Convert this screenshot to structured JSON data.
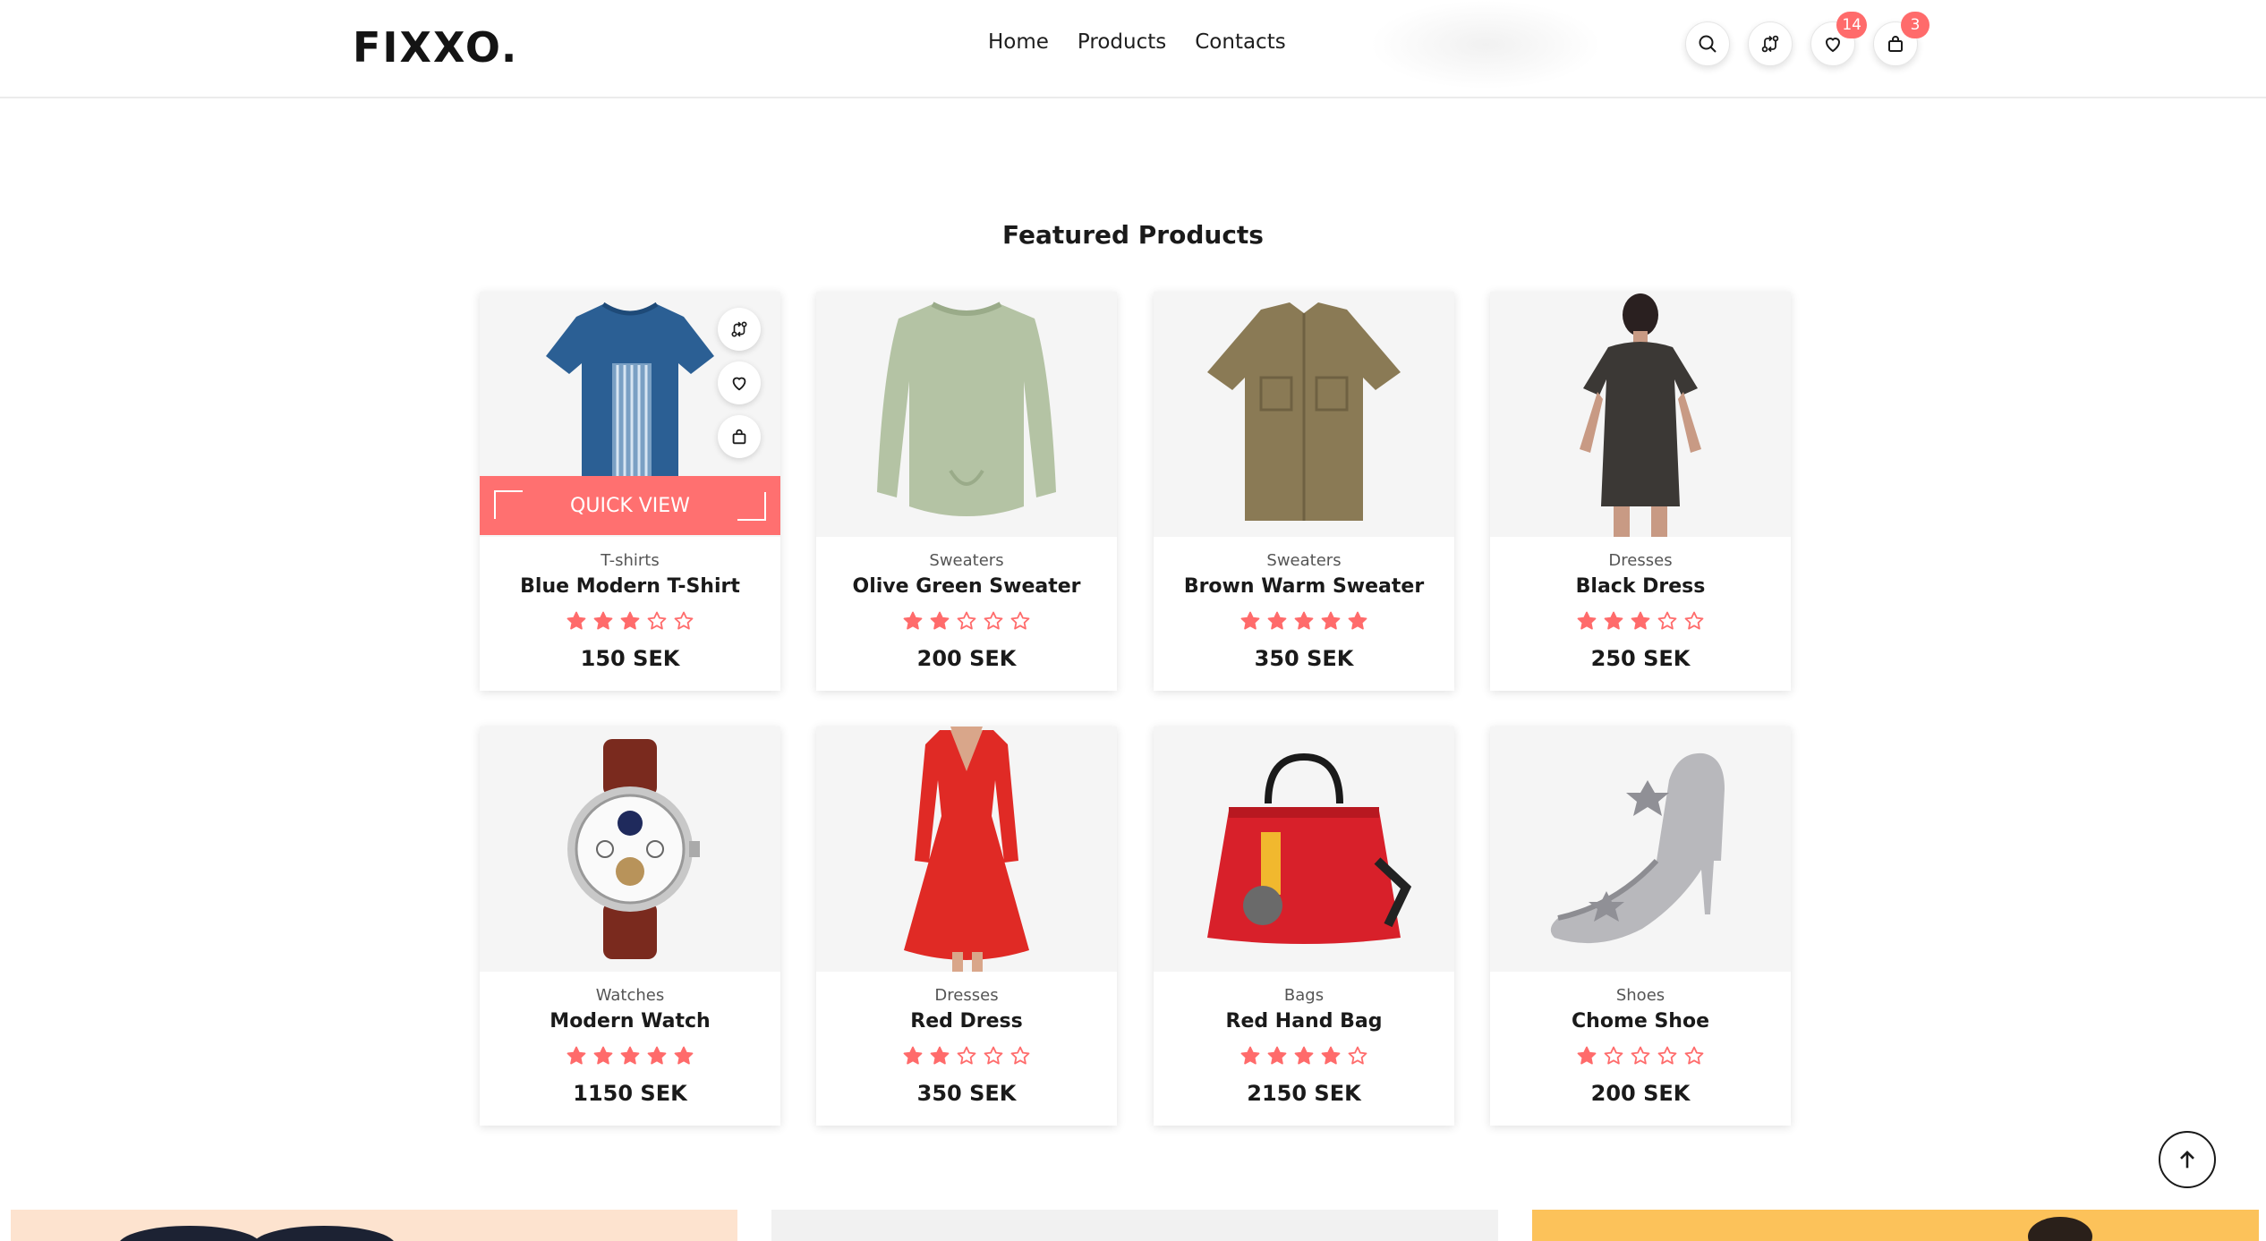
{
  "brand": {
    "logo": "FIXXO."
  },
  "nav": {
    "items": [
      "Home",
      "Products",
      "Contacts"
    ]
  },
  "header_icons": {
    "search": "search-icon",
    "compare": "compare-icon",
    "wishlist": {
      "icon": "heart-icon",
      "count": "14"
    },
    "cart": {
      "icon": "bag-icon",
      "count": "3"
    }
  },
  "section": {
    "title": "Featured Products"
  },
  "card_actions": {
    "quick_view": "QUICK VIEW"
  },
  "colors": {
    "accent": "#ff7070",
    "star": "#ff6b6b",
    "text": "#1a1a1a"
  },
  "products": [
    {
      "category": "T-shirts",
      "name": "Blue Modern T-Shirt",
      "rating": 3,
      "price": "150 SEK"
    },
    {
      "category": "Sweaters",
      "name": "Olive Green Sweater",
      "rating": 2,
      "price": "200 SEK"
    },
    {
      "category": "Sweaters",
      "name": "Brown Warm Sweater",
      "rating": 5,
      "price": "350 SEK"
    },
    {
      "category": "Dresses",
      "name": "Black Dress",
      "rating": 3,
      "price": "250 SEK"
    },
    {
      "category": "Watches",
      "name": "Modern Watch",
      "rating": 5,
      "price": "1150 SEK"
    },
    {
      "category": "Dresses",
      "name": "Red Dress",
      "rating": 2,
      "price": "350 SEK"
    },
    {
      "category": "Bags",
      "name": "Red Hand Bag",
      "rating": 4,
      "price": "2150 SEK"
    },
    {
      "category": "Shoes",
      "name": "Chome Shoe",
      "rating": 1,
      "price": "200 SEK"
    }
  ]
}
